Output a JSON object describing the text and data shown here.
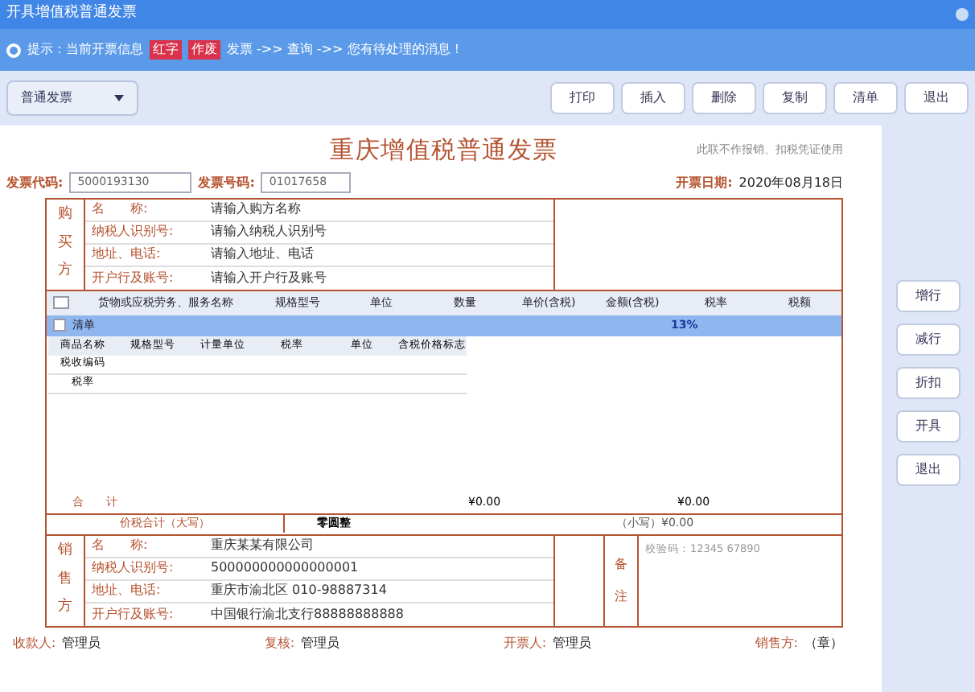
{
  "window": {
    "title": "开具增值税普通发票"
  },
  "notice": {
    "text": "提示：当前开票信息",
    "highlights": [
      "红字",
      "作废"
    ],
    "rest": "发票 ->> 查询 ->> 您有待处理的消息！"
  },
  "template": {
    "value": "普通发票"
  },
  "toolbar": [
    "打印",
    "插入",
    "删除",
    "复制",
    "清单",
    "退出"
  ],
  "invoice": {
    "title": "重庆增值税普通发票",
    "note": "此联不作报销、扣税凭证使用",
    "code_label": "发票代码:",
    "code": "5000193130",
    "number_label": "发票号码:",
    "number": "01017658",
    "date_label": "开票日期:",
    "date": "2020年08月18日",
    "buyer": {
      "side": [
        "购",
        "买",
        "方"
      ],
      "rows": [
        {
          "label": "名　　称:",
          "value": "请输入购方名称"
        },
        {
          "label": "纳税人识别号:",
          "value": "请输入纳税人识别号"
        },
        {
          "label": "地址、电话:",
          "value": "请输入地址、电话"
        },
        {
          "label": "开户行及账号:",
          "value": "请输入开户行及账号"
        }
      ]
    },
    "all_checked": false,
    "columns": [
      "货物或应税劳务、服务名称",
      "规格型号",
      "单位",
      "数量",
      "单价(含税)",
      "金额(含税)",
      "税率",
      "税额"
    ],
    "row": {
      "name": "清单",
      "checked": false,
      "rate": "13%"
    },
    "sub_columns": [
      "商品名称",
      "规格型号",
      "计量单位",
      "税率",
      "单位",
      "含税价格标志"
    ],
    "sub_rows": [
      "税收编码",
      "税率"
    ],
    "total_label": "合　　计",
    "amount": "¥0.00",
    "tax": "¥0.00",
    "sum_label": "价税合计（大写）",
    "sum_words": "零圆整",
    "sum_small": "（小写）¥0.00",
    "seller": {
      "side": [
        "销",
        "售",
        "方"
      ],
      "rows": [
        {
          "label": "名　　称:",
          "value": "重庆某某有限公司"
        },
        {
          "label": "纳税人识别号:",
          "value": "500000000000000001"
        },
        {
          "label": "地址、电话:",
          "value": "重庆市渝北区 010-98887314"
        },
        {
          "label": "开户行及账号:",
          "value": "中国银行渝北支行88888888888"
        }
      ]
    },
    "remark_side": [
      "备",
      "注"
    ],
    "remark": "校验码：12345 67890",
    "footer": [
      {
        "label": "收款人:",
        "value": "管理员"
      },
      {
        "label": "复核:",
        "value": "管理员"
      },
      {
        "label": "开票人:",
        "value": "管理员"
      },
      {
        "label": "销售方:",
        "value": "（章）"
      }
    ]
  },
  "side_buttons": [
    "增行",
    "减行",
    "折扣",
    "开具",
    "退出"
  ]
}
